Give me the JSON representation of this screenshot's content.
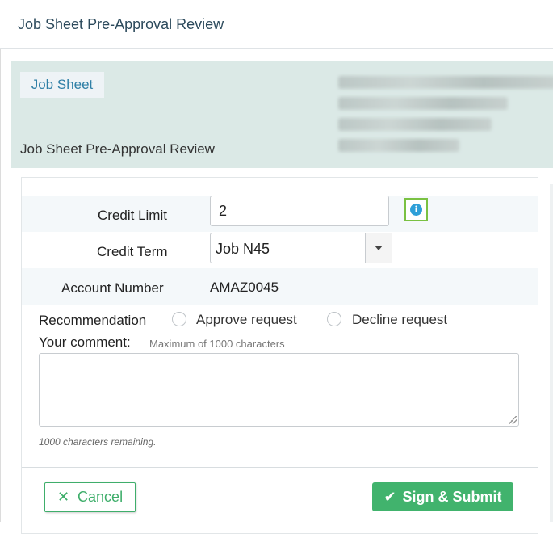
{
  "window": {
    "title": "Job Sheet Pre-Approval Review"
  },
  "header": {
    "chip_label": "Job Sheet",
    "subtitle": "Job Sheet Pre-Approval Review"
  },
  "form": {
    "credit_limit": {
      "label": "Credit Limit",
      "value": "2"
    },
    "credit_term": {
      "label": "Credit Term",
      "selected": "Job N45"
    },
    "account_number": {
      "label": "Account Number",
      "value": "AMAZ0045"
    },
    "recommendation": {
      "label": "Recommendation",
      "options": [
        "Approve request",
        "Decline request"
      ]
    },
    "comment": {
      "label": "Your comment:",
      "hint": "Maximum of 1000 characters",
      "value": "",
      "remaining": "1000 characters remaining."
    }
  },
  "actions": {
    "cancel_label": "Cancel",
    "submit_label": "Sign & Submit"
  },
  "colors": {
    "accent_green": "#41b36d",
    "info_blue": "#2e9fd8",
    "panel_bg": "#dbe9e6"
  },
  "icons": {
    "info": "info-icon",
    "cancel": "close-icon",
    "submit": "check-icon",
    "dropdown": "caret-down-icon"
  }
}
